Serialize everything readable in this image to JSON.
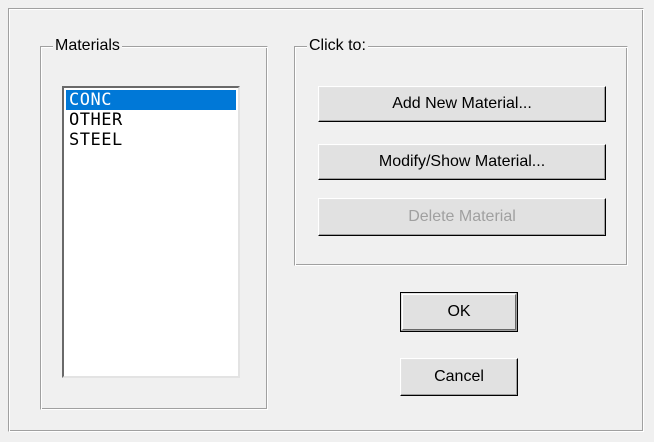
{
  "materials": {
    "legend": "Materials",
    "items": [
      {
        "label": "CONC",
        "selected": true
      },
      {
        "label": "OTHER",
        "selected": false
      },
      {
        "label": "STEEL",
        "selected": false
      }
    ]
  },
  "click_to": {
    "legend": "Click to:",
    "add_label": "Add New Material...",
    "modify_label": "Modify/Show Material...",
    "delete_label": "Delete Material"
  },
  "buttons": {
    "ok_label": "OK",
    "cancel_label": "Cancel"
  },
  "colors": {
    "selection": "#0078d7",
    "dialog_bg": "#f0f0f0"
  }
}
